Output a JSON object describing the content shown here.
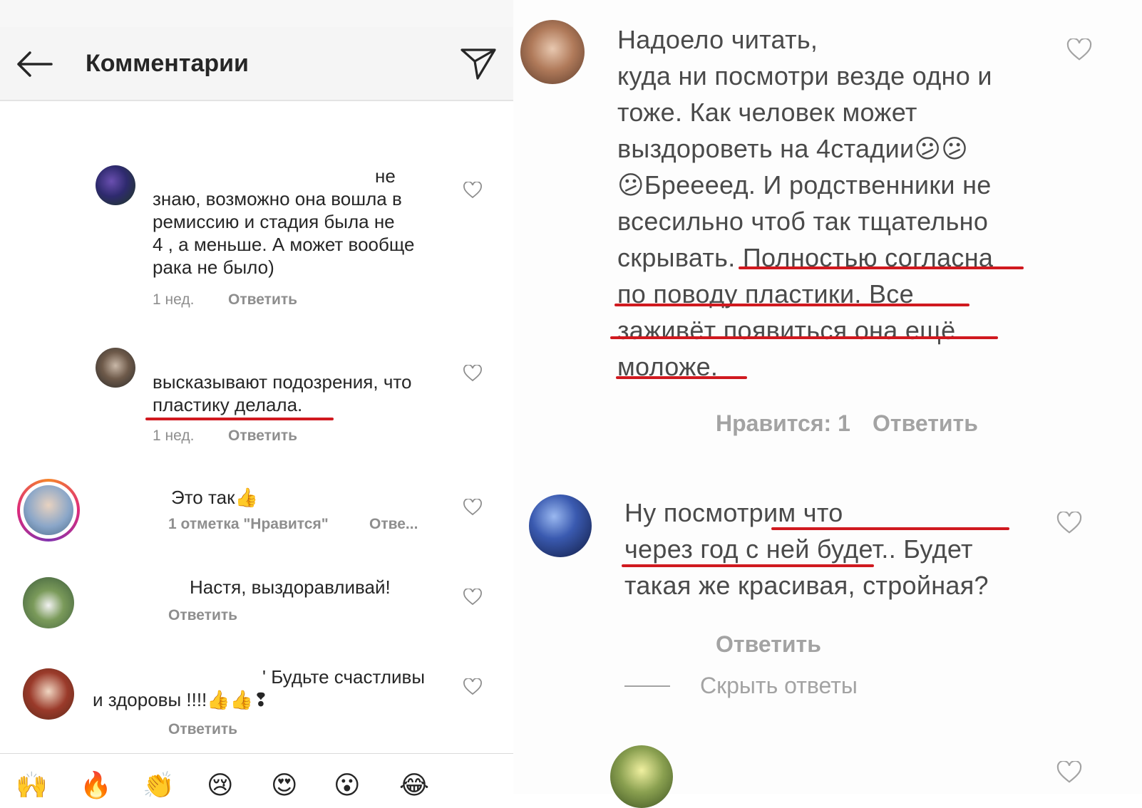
{
  "left": {
    "header": {
      "title": "Комментарии",
      "back_icon": "arrow-left-icon",
      "send_icon": "paper-plane-icon"
    },
    "comments": [
      {
        "text_first": "не",
        "text_rest": "знаю, возможно она вошла в\nремиссию и стадия была не\n4 , а меньше. А может вообще\nрака не было)",
        "time": "1 нед.",
        "reply": "Ответить"
      },
      {
        "text": "высказывают подозрения, что\nпластику делала.",
        "time": "1 нед.",
        "reply": "Ответить"
      },
      {
        "text": "Это так👍",
        "likes": "1 отметка \"Нравится\"",
        "reply": "Отве..."
      },
      {
        "text": "Настя, выздоравливай!",
        "reply": "Ответить"
      },
      {
        "text_first": "' Будьте счастливы",
        "text_rest": "и здоровы !!!!👍👍❢",
        "reply": "Ответить"
      }
    ],
    "emoji_bar": [
      "🙌",
      "🔥",
      "👏",
      "😢",
      "😍",
      "😮",
      "😂"
    ]
  },
  "right": {
    "comments": [
      {
        "text": "Надоело читать,\nкуда ни посмотри везде одно и\nтоже. Как человек может\nвыздороветь на 4стадии😕😕\n😕Бреееед. И родственники не\nвсесильно чтоб так тщательно\nскрывать. Полностью согласна\nпо поводу пластики. Все\nзаживёт появиться она ещё\nмоложе.",
        "likes": "Нравится: 1",
        "reply": "Ответить"
      },
      {
        "text": "Ну посмотрим что\nчерез год с ней будет.. Будет\nтакая же красивая, стройная?",
        "reply": "Ответить",
        "hide_replies": "Скрыть ответы"
      }
    ]
  },
  "colors": {
    "underline": "#d0191f",
    "meta": "#8e8e8e",
    "text": "#262626"
  }
}
